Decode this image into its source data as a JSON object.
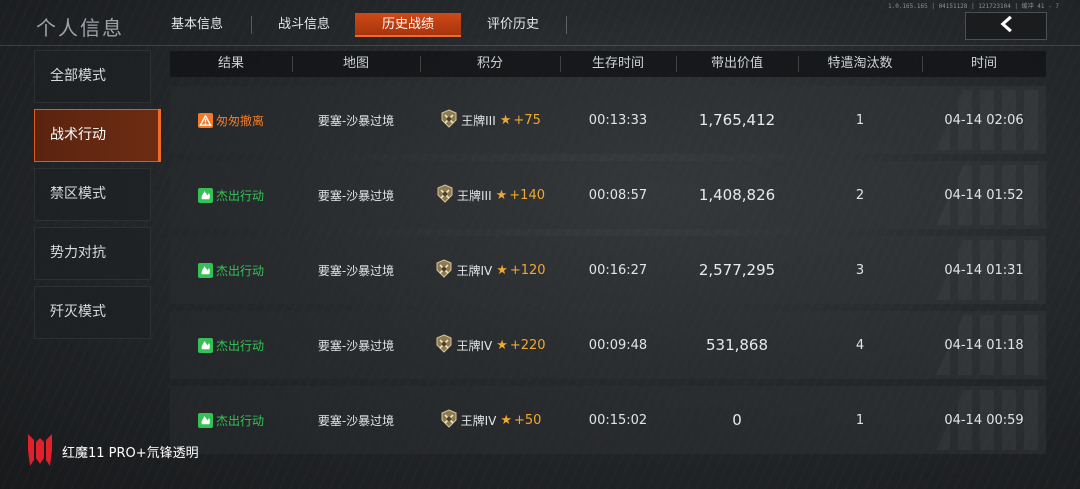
{
  "title": "个人信息",
  "build_info": "1.0.165.165 | 04151128 | 121723104 | 缓冲 41 - 7",
  "tabs": [
    {
      "label": "基本信息",
      "active": false
    },
    {
      "label": "战斗信息",
      "active": false
    },
    {
      "label": "历史战绩",
      "active": true
    },
    {
      "label": "评价历史",
      "active": false
    }
  ],
  "modes": [
    {
      "label": "全部模式",
      "active": false
    },
    {
      "label": "战术行动",
      "active": true
    },
    {
      "label": "禁区模式",
      "active": false
    },
    {
      "label": "势力对抗",
      "active": false
    },
    {
      "label": "歼灭模式",
      "active": false
    }
  ],
  "columns": [
    "结果",
    "地图",
    "积分",
    "生存时间",
    "带出价值",
    "特遣淘汰数",
    "时间"
  ],
  "rows": [
    {
      "result": "匆匆撤离",
      "result_type": "warning",
      "map": "要塞-沙暴过境",
      "rank": "王牌III",
      "score": "+75",
      "survival": "00:13:33",
      "value": "1,765,412",
      "kills": "1",
      "time": "04-14 02:06"
    },
    {
      "result": "杰出行动",
      "result_type": "success",
      "map": "要塞-沙暴过境",
      "rank": "王牌III",
      "score": "+140",
      "survival": "00:08:57",
      "value": "1,408,826",
      "kills": "2",
      "time": "04-14 01:52"
    },
    {
      "result": "杰出行动",
      "result_type": "success",
      "map": "要塞-沙暴过境",
      "rank": "王牌IV",
      "score": "+120",
      "survival": "00:16:27",
      "value": "2,577,295",
      "kills": "3",
      "time": "04-14 01:31"
    },
    {
      "result": "杰出行动",
      "result_type": "success",
      "map": "要塞-沙暴过境",
      "rank": "王牌IV",
      "score": "+220",
      "survival": "00:09:48",
      "value": "531,868",
      "kills": "4",
      "time": "04-14 01:18"
    },
    {
      "result": "杰出行动",
      "result_type": "success",
      "map": "要塞-沙暴过境",
      "rank": "王牌IV",
      "score": "+50",
      "survival": "00:15:02",
      "value": "0",
      "kills": "1",
      "time": "04-14 00:59"
    }
  ],
  "colors": {
    "warning": "#f07a2a",
    "success": "#35c255",
    "accent": "#d4461a",
    "score": "#f0a830"
  },
  "watermark": "红魔11 PRO+氘锋透明"
}
